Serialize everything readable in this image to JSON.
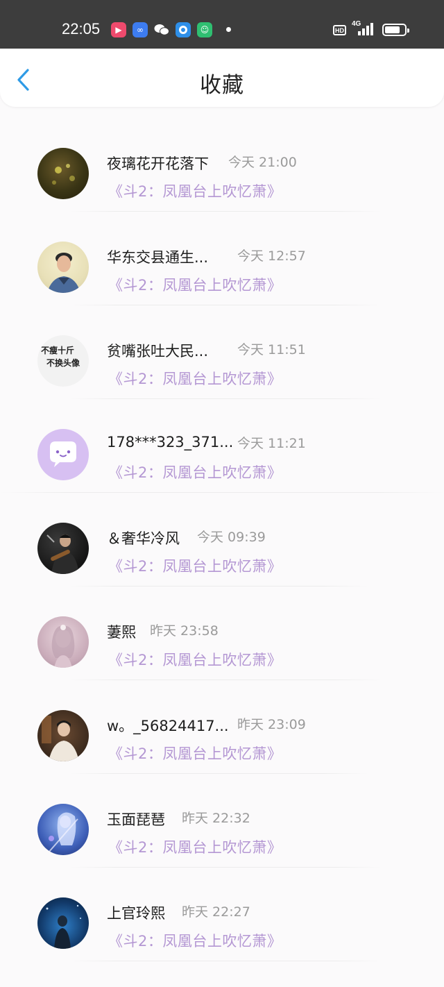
{
  "status_bar": {
    "time": "22:05",
    "hd_label": "HD",
    "network_label": "4G",
    "apps": [
      {
        "icon": "video-app-icon",
        "color": "#ef4a6d",
        "glyph": "▶"
      },
      {
        "icon": "infinity-app-icon",
        "color": "#3d7cf0",
        "glyph": "∞"
      },
      {
        "icon": "wechat-icon",
        "color": "#3d3d3d",
        "glyph": "✉"
      },
      {
        "icon": "browser-app-icon",
        "color": "#2e8fe8",
        "glyph": "◉"
      },
      {
        "icon": "shop-app-icon",
        "color": "#2fbf71",
        "glyph": "☺"
      }
    ]
  },
  "header": {
    "title": "收藏"
  },
  "favorites": [
    {
      "user": "夜璃花开花落下",
      "time": "今天 21:00",
      "work": "《斗2：凤凰台上吹忆萧》"
    },
    {
      "user": "华东交县通生...",
      "time": "今天 12:57",
      "work": "《斗2：凤凰台上吹忆萧》"
    },
    {
      "user": "贫嘴张吐大民...",
      "time": "今天 11:51",
      "work": "《斗2：凤凰台上吹忆萧》"
    },
    {
      "user": "178***323_371...",
      "time": "今天 11:21",
      "work": "《斗2：凤凰台上吹忆萧》"
    },
    {
      "user": "＆奢华冷风",
      "time": "今天 09:39",
      "work": "《斗2：凤凰台上吹忆萧》"
    },
    {
      "user": "萋熙",
      "time": "昨天 23:58",
      "work": "《斗2：凤凰台上吹忆萧》"
    },
    {
      "user": "w。_56824417...",
      "time": "昨天 23:09",
      "work": "《斗2：凤凰台上吹忆萧》"
    },
    {
      "user": "玉面琵琶",
      "time": "昨天 22:32",
      "work": "《斗2：凤凰台上吹忆萧》"
    },
    {
      "user": "上官玲熙",
      "time": "昨天 22:27",
      "work": "《斗2：凤凰台上吹忆萧》"
    }
  ],
  "avatar_texts": {
    "line1": "不瘦十斤",
    "line2": "不换头像"
  },
  "colors": {
    "accent_blue": "#2f9be6",
    "work_title": "#b497d3",
    "default_avatar": "#d7c0f2"
  }
}
